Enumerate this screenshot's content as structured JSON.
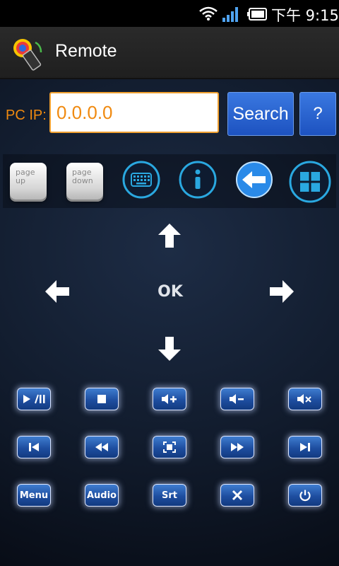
{
  "status": {
    "time": "下午 9:15",
    "icons": [
      "wifi-icon",
      "signal-icon",
      "battery-icon"
    ]
  },
  "app": {
    "title": "Remote",
    "icon": "app-logo-icon"
  },
  "ip": {
    "label": "PC IP:",
    "value": "0.0.0.0"
  },
  "buttons": {
    "search": "Search",
    "help": "?"
  },
  "toolbar": {
    "page_up": [
      "page",
      "up"
    ],
    "page_down": [
      "page",
      "down"
    ],
    "icons": [
      "keyboard-icon",
      "info-icon",
      "back-arrow-icon",
      "windows-logo-icon"
    ]
  },
  "dpad": {
    "ok": "OK"
  },
  "controls": {
    "row1": [
      "play-pause-icon",
      "stop-icon",
      "volume-up-icon",
      "volume-down-icon",
      "mute-icon"
    ],
    "row2": [
      "skip-previous-icon",
      "rewind-icon",
      "fullscreen-icon",
      "fast-forward-icon",
      "skip-next-icon"
    ],
    "row3_labels": {
      "menu": "Menu",
      "audio": "Audio",
      "srt": "Srt"
    },
    "row3_icons": [
      "close-icon",
      "power-icon"
    ]
  },
  "colors": {
    "accent_orange": "#f08a10",
    "button_blue": "#2a64d0",
    "icon_cyan": "#2aa8e0"
  }
}
